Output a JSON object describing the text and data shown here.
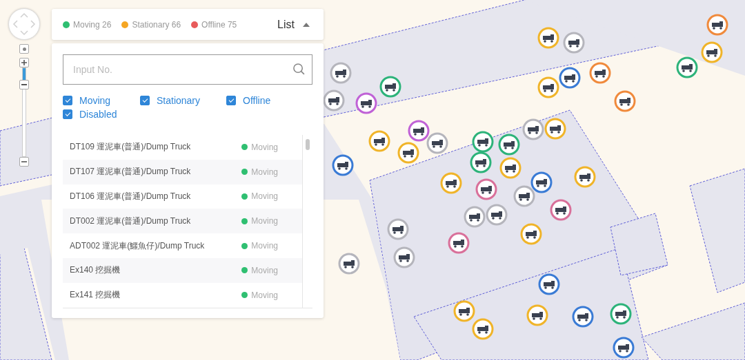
{
  "legend": [
    {
      "label": "Moving 26",
      "color": "#2fbf71"
    },
    {
      "label": "Stationary 66",
      "color": "#f5a623"
    },
    {
      "label": "Offline 75",
      "color": "#e85b5b"
    }
  ],
  "list_toggle": {
    "label": "List",
    "expanded": true
  },
  "search": {
    "placeholder": "Input No."
  },
  "filters": [
    {
      "label": "Moving",
      "checked": true
    },
    {
      "label": "Stationary",
      "checked": true
    },
    {
      "label": "Offline",
      "checked": true
    },
    {
      "label": "Disabled",
      "checked": true
    }
  ],
  "vehicles": [
    {
      "name": "DT109 運泥車(普通)/Dump Truck",
      "status": "Moving",
      "color": "#2fbf71"
    },
    {
      "name": "DT107 運泥車(普通)/Dump Truck",
      "status": "Moving",
      "color": "#2fbf71"
    },
    {
      "name": "DT106 運泥車(普通)/Dump Truck",
      "status": "Moving",
      "color": "#2fbf71"
    },
    {
      "name": "DT002 運泥車(普通)/Dump Truck",
      "status": "Moving",
      "color": "#2fbf71"
    },
    {
      "name": "ADT002 運泥車(鱷魚仔)/Dump Truck",
      "status": "Moving",
      "color": "#2fbf71"
    },
    {
      "name": "Ex140 挖掘機",
      "status": "Moving",
      "color": "#2fbf71"
    },
    {
      "name": "Ex141 挖掘機",
      "status": "Moving",
      "color": "#2fbf71"
    }
  ],
  "zoom": {
    "level": 0.17
  },
  "markers": [
    {
      "color": "#f0b429"
    },
    {
      "color": "#b5b5bc"
    },
    {
      "color": "#3a7bd5"
    },
    {
      "color": "#f08a3c"
    },
    {
      "color": "#f0b429"
    },
    {
      "color": "#f08a3c"
    },
    {
      "color": "#f0b429"
    },
    {
      "color": "#2db37a"
    },
    {
      "color": "#f08a3c"
    },
    {
      "color": "#b5b5bc"
    },
    {
      "color": "#b5b5bc"
    },
    {
      "color": "#c062d6"
    },
    {
      "color": "#2db37a"
    },
    {
      "color": "#3a7bd5"
    },
    {
      "color": "#f0b429"
    },
    {
      "color": "#c062d6"
    },
    {
      "color": "#f0b429"
    },
    {
      "color": "#b5b5bc"
    },
    {
      "color": "#2db37a"
    },
    {
      "color": "#2db37a"
    },
    {
      "color": "#b5b5bc"
    },
    {
      "color": "#f0b429"
    },
    {
      "color": "#2db37a"
    },
    {
      "color": "#f0b429"
    },
    {
      "color": "#3a7bd5"
    },
    {
      "color": "#f0b429"
    },
    {
      "color": "#f0b429"
    },
    {
      "color": "#d9709a"
    },
    {
      "color": "#b5b5bc"
    },
    {
      "color": "#b5b5bc"
    },
    {
      "color": "#b5b5bc"
    },
    {
      "color": "#d9709a"
    },
    {
      "color": "#b5b5bc"
    },
    {
      "color": "#d9709a"
    },
    {
      "color": "#f0b429"
    },
    {
      "color": "#b5b5bc"
    },
    {
      "color": "#b5b5bc"
    },
    {
      "color": "#3a7bd5"
    },
    {
      "color": "#f0b429"
    },
    {
      "color": "#3a7bd5"
    },
    {
      "color": "#f0b429"
    },
    {
      "color": "#f0b429"
    },
    {
      "color": "#2db37a"
    },
    {
      "color": "#3a7bd5"
    }
  ]
}
